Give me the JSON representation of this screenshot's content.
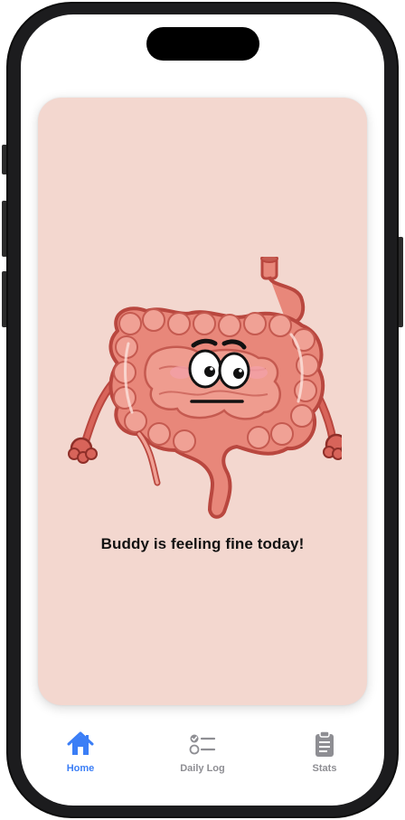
{
  "status": {
    "message": "Buddy is feeling fine today!"
  },
  "mascot": {
    "icon": "intestine-mascot-icon",
    "mood": "neutral"
  },
  "tabbar": {
    "tabs": [
      {
        "id": "home",
        "label": "Home",
        "icon": "house-icon",
        "active": true
      },
      {
        "id": "daily-log",
        "label": "Daily Log",
        "icon": "checklist-icon",
        "active": false
      },
      {
        "id": "stats",
        "label": "Stats",
        "icon": "clipboard-icon",
        "active": false
      }
    ]
  },
  "colors": {
    "card_background": "#f3d7cf",
    "accent": "#3b7ef6",
    "inactive": "#8e8e93",
    "mascot_body": "#e8877a",
    "mascot_outline": "#b9473f"
  }
}
